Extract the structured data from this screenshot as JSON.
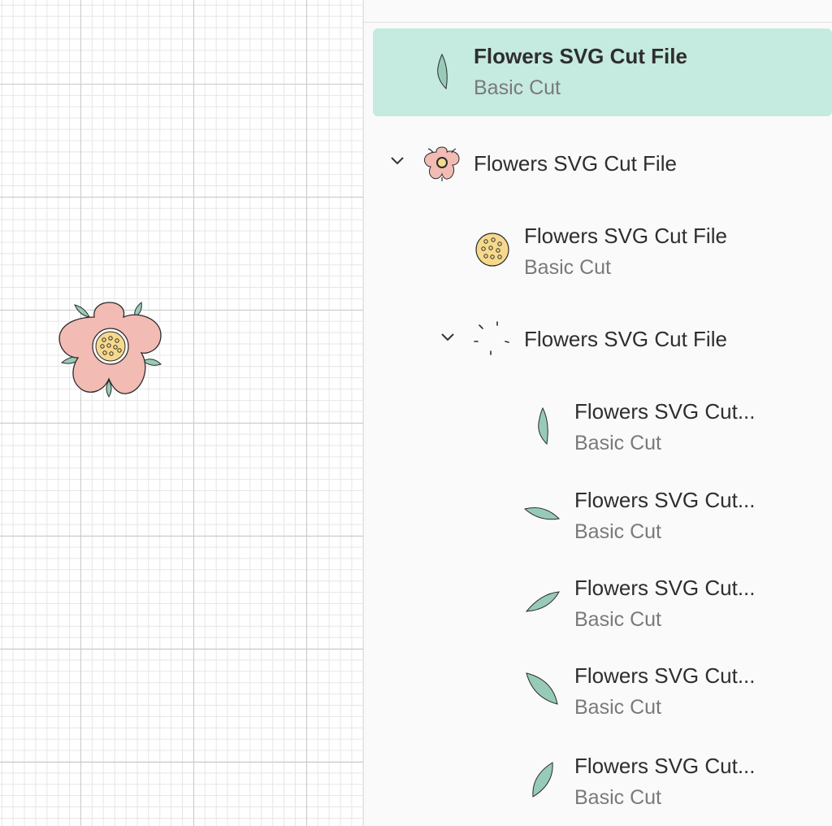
{
  "layers": [
    {
      "title": "Flowers SVG Cut File",
      "subtitle": "Basic Cut",
      "icon": "leaf-icon",
      "selected": true
    },
    {
      "title": "Flowers SVG Cut File",
      "icon": "flower-group-icon",
      "expanded": true
    },
    {
      "title": "Flowers SVG Cut File",
      "subtitle": "Basic Cut",
      "icon": "flower-center-icon"
    },
    {
      "title": "Flowers SVG Cut File",
      "icon": "leaves-group-icon",
      "expanded": true
    },
    {
      "title": "Flowers SVG Cut...",
      "subtitle": "Basic Cut",
      "icon": "leaf-icon"
    },
    {
      "title": "Flowers SVG Cut...",
      "subtitle": "Basic Cut",
      "icon": "leaf-icon"
    },
    {
      "title": "Flowers SVG Cut...",
      "subtitle": "Basic Cut",
      "icon": "leaf-icon"
    },
    {
      "title": "Flowers SVG Cut...",
      "subtitle": "Basic Cut",
      "icon": "leaf-icon"
    },
    {
      "title": "Flowers SVG Cut...",
      "subtitle": "Basic Cut",
      "icon": "leaf-icon"
    }
  ],
  "colors": {
    "selected_row": "#c5eadf",
    "petal": "#f2bbb4",
    "leaf": "#97cbb7",
    "center": "#f6d98c"
  }
}
